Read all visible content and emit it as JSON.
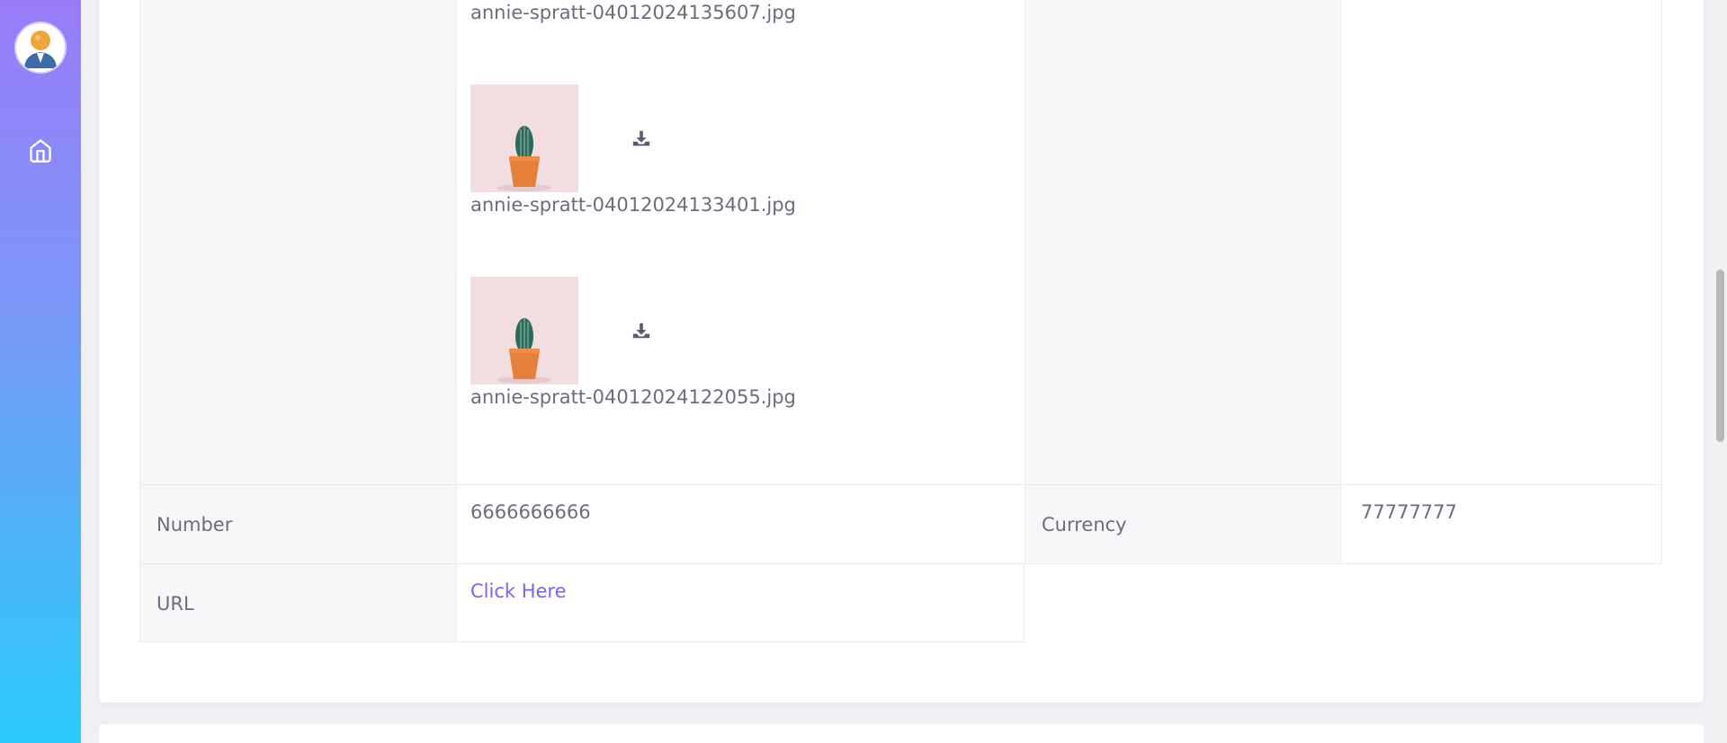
{
  "sidebar": {
    "avatar_alt": "user avatar",
    "nav": [
      {
        "icon": "home-icon"
      }
    ]
  },
  "attachments": [
    {
      "filename": "annie-spratt-04012024135607.jpg"
    },
    {
      "filename": "annie-spratt-04012024133401.jpg"
    },
    {
      "filename": "annie-spratt-04012024122055.jpg"
    }
  ],
  "fields": {
    "number_label": "Number",
    "number_value": "6666666666",
    "currency_label": "Currency",
    "currency_value": "77777777",
    "url_label": "URL",
    "url_link_text": "Click Here"
  },
  "colors": {
    "accent": "#7367f0",
    "text": "#6e6b7b",
    "label_bg": "#f7f7f9"
  }
}
